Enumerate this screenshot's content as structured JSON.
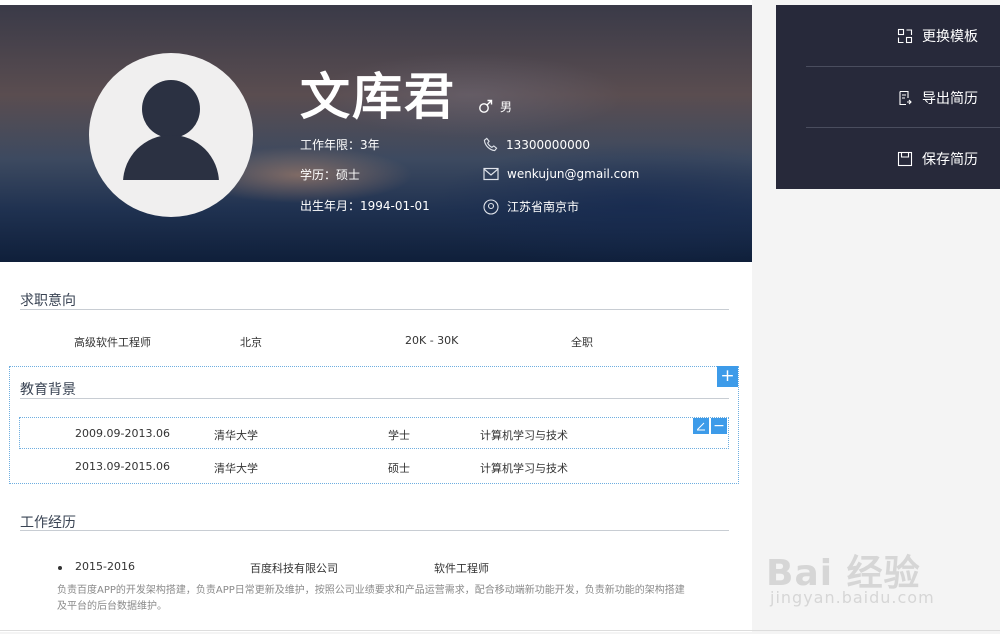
{
  "header": {
    "name": "文库君",
    "gender": "男",
    "work_years": "工作年限：3年",
    "education": "学历：硕士",
    "birth": "出生年月：1994-01-01",
    "phone": "13300000000",
    "email": "wenkujun@gmail.com",
    "location": "江苏省南京市"
  },
  "job_intent": {
    "title": "求职意向",
    "position": "高级软件工程师",
    "city": "北京",
    "salary": "20K - 30K",
    "type": "全职"
  },
  "education": {
    "title": "教育背景",
    "add_label": "+",
    "delete_label": "−",
    "rows": [
      {
        "period": "2009.09-2013.06",
        "school": "清华大学",
        "degree": "学士",
        "major": "计算机学习与技术"
      },
      {
        "period": "2013.09-2015.06",
        "school": "清华大学",
        "degree": "硕士",
        "major": "计算机学习与技术"
      }
    ]
  },
  "work": {
    "title": "工作经历",
    "period": "2015-2016",
    "company": "百度科技有限公司",
    "role": "软件工程师",
    "description": "负责百度APP的开发架构搭建，负责APP日常更新及维护，按照公司业绩要求和产品运营需求，配合移动端新功能开发，负责新功能的架构搭建及平台的后台数据维护。"
  },
  "sidebar": {
    "items": [
      {
        "label": "更换模板",
        "icon": "template-icon"
      },
      {
        "label": "导出简历",
        "icon": "export-icon"
      },
      {
        "label": "保存简历",
        "icon": "save-icon"
      }
    ]
  },
  "watermark": {
    "brand": "Bai  经验",
    "url": "jingyan.baidu.com"
  },
  "colors": {
    "accent": "#3d9be9",
    "sidebar_bg": "#27293a"
  }
}
